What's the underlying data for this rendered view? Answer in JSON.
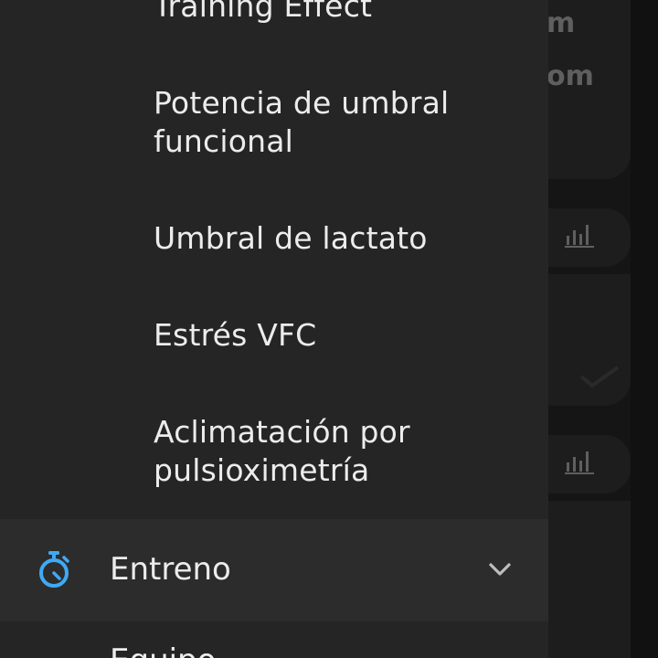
{
  "background": {
    "partial_text_1": "m",
    "partial_text_2": "om",
    "chart_icon_1": "bar-chart-icon",
    "chart_icon_2": "bar-chart-icon",
    "check_icon": "checkmark-icon"
  },
  "drawer": {
    "items": [
      {
        "label": "Training Effect"
      },
      {
        "label": "Potencia de umbral funcional"
      },
      {
        "label": "Umbral de lactato"
      },
      {
        "label": "Estrés VFC"
      },
      {
        "label": "Aclimatación por pulsioximetría"
      }
    ],
    "section": {
      "label": "Entreno",
      "icon": "stopwatch-icon",
      "accent_color": "#3fa9f5",
      "expand_icon": "chevron-down-icon"
    },
    "next_item": {
      "label": "Equipo"
    }
  }
}
